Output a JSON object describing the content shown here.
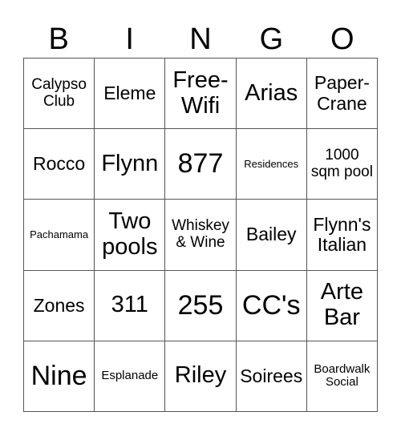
{
  "header": [
    "B",
    "I",
    "N",
    "G",
    "O"
  ],
  "cells": [
    [
      "Calypso Club",
      "Eleme",
      "Free-Wifi",
      "Arias",
      "Paper-Crane"
    ],
    [
      "Rocco",
      "Flynn",
      "877",
      "Residences",
      "1000 sqm pool"
    ],
    [
      "Pachamama",
      "Two pools",
      "Whiskey & Wine",
      "Bailey",
      "Flynn's Italian"
    ],
    [
      "Zones",
      "311",
      "255",
      "CC's",
      "Arte Bar"
    ],
    [
      "Nine",
      "Esplanade",
      "Riley",
      "Soirees",
      "Boardwalk Social"
    ]
  ]
}
